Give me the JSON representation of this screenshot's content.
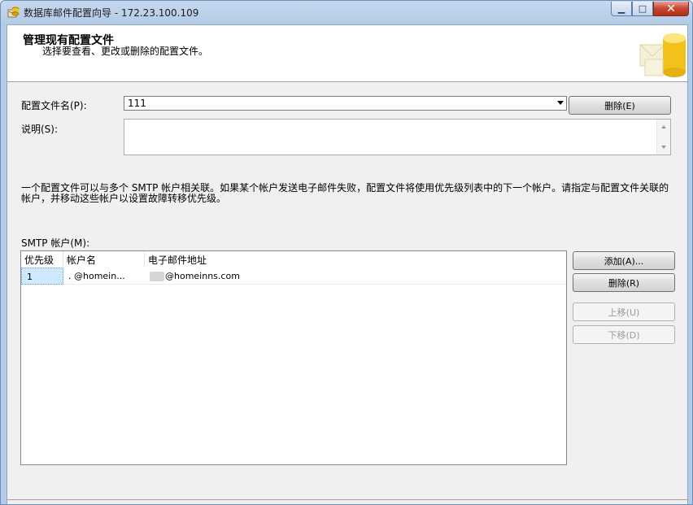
{
  "window": {
    "title": "数据库邮件配置向导 - 172.23.100.109",
    "minimize": "▁",
    "maximize": "□",
    "close": "✕"
  },
  "header": {
    "title": "管理现有配置文件",
    "subtitle": "选择要查看、更改或删除的配置文件。"
  },
  "profile": {
    "name_label": "配置文件名(P):",
    "name_value": "111",
    "delete_label": "删除(E)",
    "description_label": "说明(S):",
    "description_value": ""
  },
  "info_text": "一个配置文件可以与多个 SMTP 帐户相关联。如果某个帐户发送电子邮件失败，配置文件将使用优先级列表中的下一个帐户。请指定与配置文件关联的帐户，并移动这些帐户以设置故障转移优先级。",
  "smtp": {
    "label": "SMTP 帐户(M):",
    "columns": [
      "优先级",
      "帐户名",
      "电子邮件地址"
    ],
    "rows": [
      {
        "priority": "1",
        "account": ".  @homein...",
        "email": "@homeinns.com"
      }
    ],
    "buttons": {
      "add": "添加(A)...",
      "remove": "删除(R)",
      "move_up": "上移(U)",
      "move_down": "下移(D)"
    }
  }
}
